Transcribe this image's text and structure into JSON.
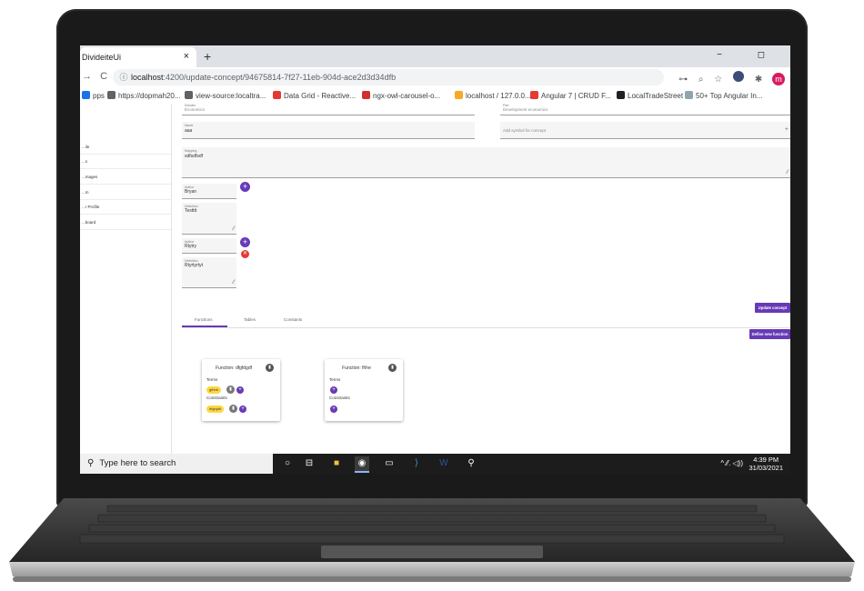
{
  "browser": {
    "tab_title": "DivideiteUi",
    "tab_close": "×",
    "new_tab": "+",
    "window_controls": "− ◻",
    "nav_back": "→",
    "nav_reload": "C",
    "url_host": "localhost",
    "url_rest": ":4200/update-concept/94675814-7f27-11eb-904d-ace2d3d34dfb",
    "profile_initial": "m",
    "bookmarks": [
      {
        "label": "pps",
        "color": "#1a73e8"
      },
      {
        "label": "https://dopmah20...",
        "color": "#5f6368"
      },
      {
        "label": "view-source:localtra...",
        "color": "#5f6368"
      },
      {
        "label": "Data Grid - Reactive...",
        "color": "#e53935"
      },
      {
        "label": "ngx-owl-carousel-o...",
        "color": "#d32f2f"
      },
      {
        "label": "localhost / 127.0.0....",
        "color": "#f9a825"
      },
      {
        "label": "Angular 7 | CRUD F...",
        "color": "#e53935"
      },
      {
        "label": "LocalTradeStreet",
        "color": "#202124"
      },
      {
        "label": "50+ Top Angular In...",
        "color": "#90a4ae"
      }
    ]
  },
  "sidenav": {
    "items": [
      "...ile",
      "...s",
      "...mages",
      "...m",
      "...r Profile",
      "...board"
    ]
  },
  "form": {
    "domain_label": "Domain",
    "domain_value": "Economics",
    "part_label": "Part",
    "part_value": "Development economics",
    "name_label": "Name",
    "name_value": "aaa",
    "synonym_placeholder": "Add symbol for concept",
    "synonym_plus": "+",
    "mapping_label": "Mapping",
    "mapping_value": "sdfsdfsdf",
    "author1_label": "Author",
    "author1_value": "Bryan",
    "definition1_label": "Definition",
    "definition1_value": "Testttt",
    "author2_label": "Author",
    "author2_value": "Rtytry",
    "definition2_label": "Definition",
    "definition2_value": "Rtyrtyrtyt",
    "add_symbol": "+",
    "delete_symbol": "✕",
    "update_button": "Update concept",
    "define_function_button": "Define new function"
  },
  "tabs": [
    "Functions",
    "Tables",
    "Constants"
  ],
  "functions": [
    {
      "title": "Function: dfgfdgdf",
      "terms_label": "Terms",
      "term_chip": "gfhhh",
      "constraints_label": "Constraints",
      "constraint_chip": "hfghjdh"
    },
    {
      "title": "Function: fhhe",
      "terms_label": "Terms",
      "constraints_label": "Constraints"
    }
  ],
  "taskbar": {
    "search_placeholder": "Type here to search",
    "time": "4:39 PM",
    "date": "31/03/2021",
    "tray": "^ ⁄⁄. ◁))"
  },
  "colors": {
    "accent": "#673ab7",
    "chip": "#ffd740",
    "danger": "#e53935"
  }
}
